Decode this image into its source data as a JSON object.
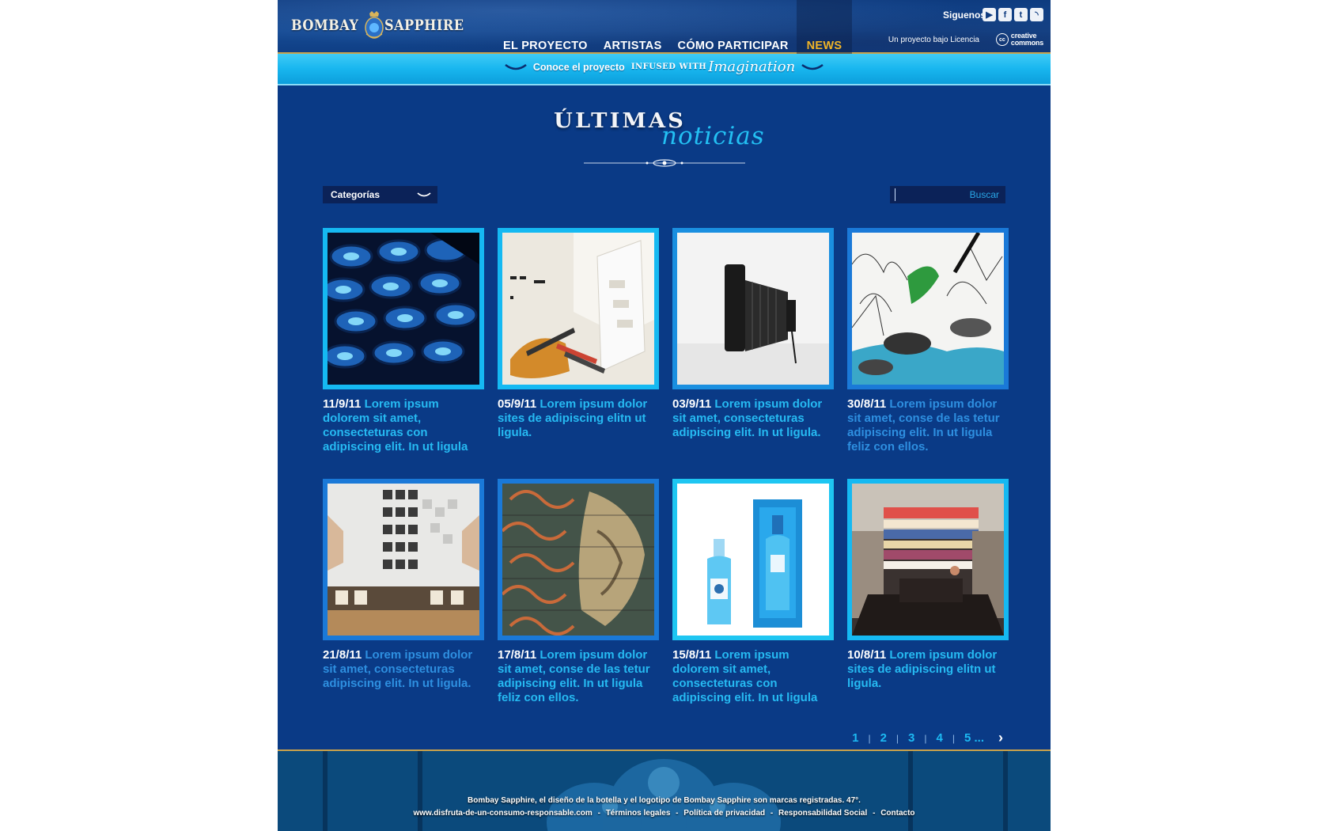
{
  "header": {
    "logo_left": "BOMBAY",
    "logo_right": "SAPPHIRE",
    "nav": [
      "EL PROYECTO",
      "ARTISTAS",
      "CÓMO PARTICIPAR",
      "NEWS"
    ],
    "follow_label": "Siguenos",
    "social_icons": [
      "youtube-icon",
      "facebook-icon",
      "twitter-icon",
      "rss-icon"
    ],
    "license_text": "Un proyecto bajo Licencia",
    "cc_text_1": "creative",
    "cc_text_2": "commons",
    "cc_symbol": "cc"
  },
  "banner": {
    "prefix": "Conoce el proyecto",
    "infused": "INFUSED WITH",
    "imagination": "Imagination"
  },
  "title": {
    "line1": "ÚLTIMAS",
    "line2": "noticias"
  },
  "filters": {
    "categories_label": "Categorías",
    "search_button": "Buscar",
    "search_placeholder": ""
  },
  "news": [
    {
      "date": "11/9/11",
      "text": "Lorem ipsum dolorem sit amet, consecteturas con adipiscing elit. In ut ligula"
    },
    {
      "date": "05/9/11",
      "text": "Lorem ipsum dolor sites de adipiscing elitn ut ligula."
    },
    {
      "date": "03/9/11",
      "text": "Lorem ipsum dolor sit amet, consecteturas adipiscing elit. In ut ligula."
    },
    {
      "date": "30/8/11",
      "text": "Lorem ipsum dolor sit amet, conse de las tetur adipiscing elit. In ut ligula feliz con ellos."
    },
    {
      "date": "21/8/11",
      "text": "Lorem ipsum dolor sit amet, consecteturas adipiscing elit. In ut ligula."
    },
    {
      "date": "17/8/11",
      "text": "Lorem ipsum dolor sit amet, conse de las tetur adipiscing elit. In ut ligula feliz con ellos."
    },
    {
      "date": "15/8/11",
      "text": "Lorem ipsum dolorem sit amet, consecteturas con adipiscing elit. In ut ligula"
    },
    {
      "date": "10/8/11",
      "text": "Lorem ipsum dolor sites de adipiscing elitn ut ligula."
    }
  ],
  "pagination": {
    "pages": [
      "1",
      "2",
      "3",
      "4",
      "5 ..."
    ],
    "separator": "|",
    "next": "›"
  },
  "footer": {
    "legal": "Bombay Sapphire, el diseño de la botella y el logotipo de Bombay Sapphire son marcas registradas. 47°.",
    "links": [
      "www.disfruta-de-un-consumo-responsable.com",
      "Términos legales",
      "Política de privacidad",
      "Responsabilidad Social",
      "Contacto"
    ],
    "link_separator": "-"
  },
  "colors": {
    "background": "#0a3a86",
    "accent_cyan": "#26baf2",
    "nav_active": "#f0b427",
    "gold_rule": "#c9a24b"
  }
}
